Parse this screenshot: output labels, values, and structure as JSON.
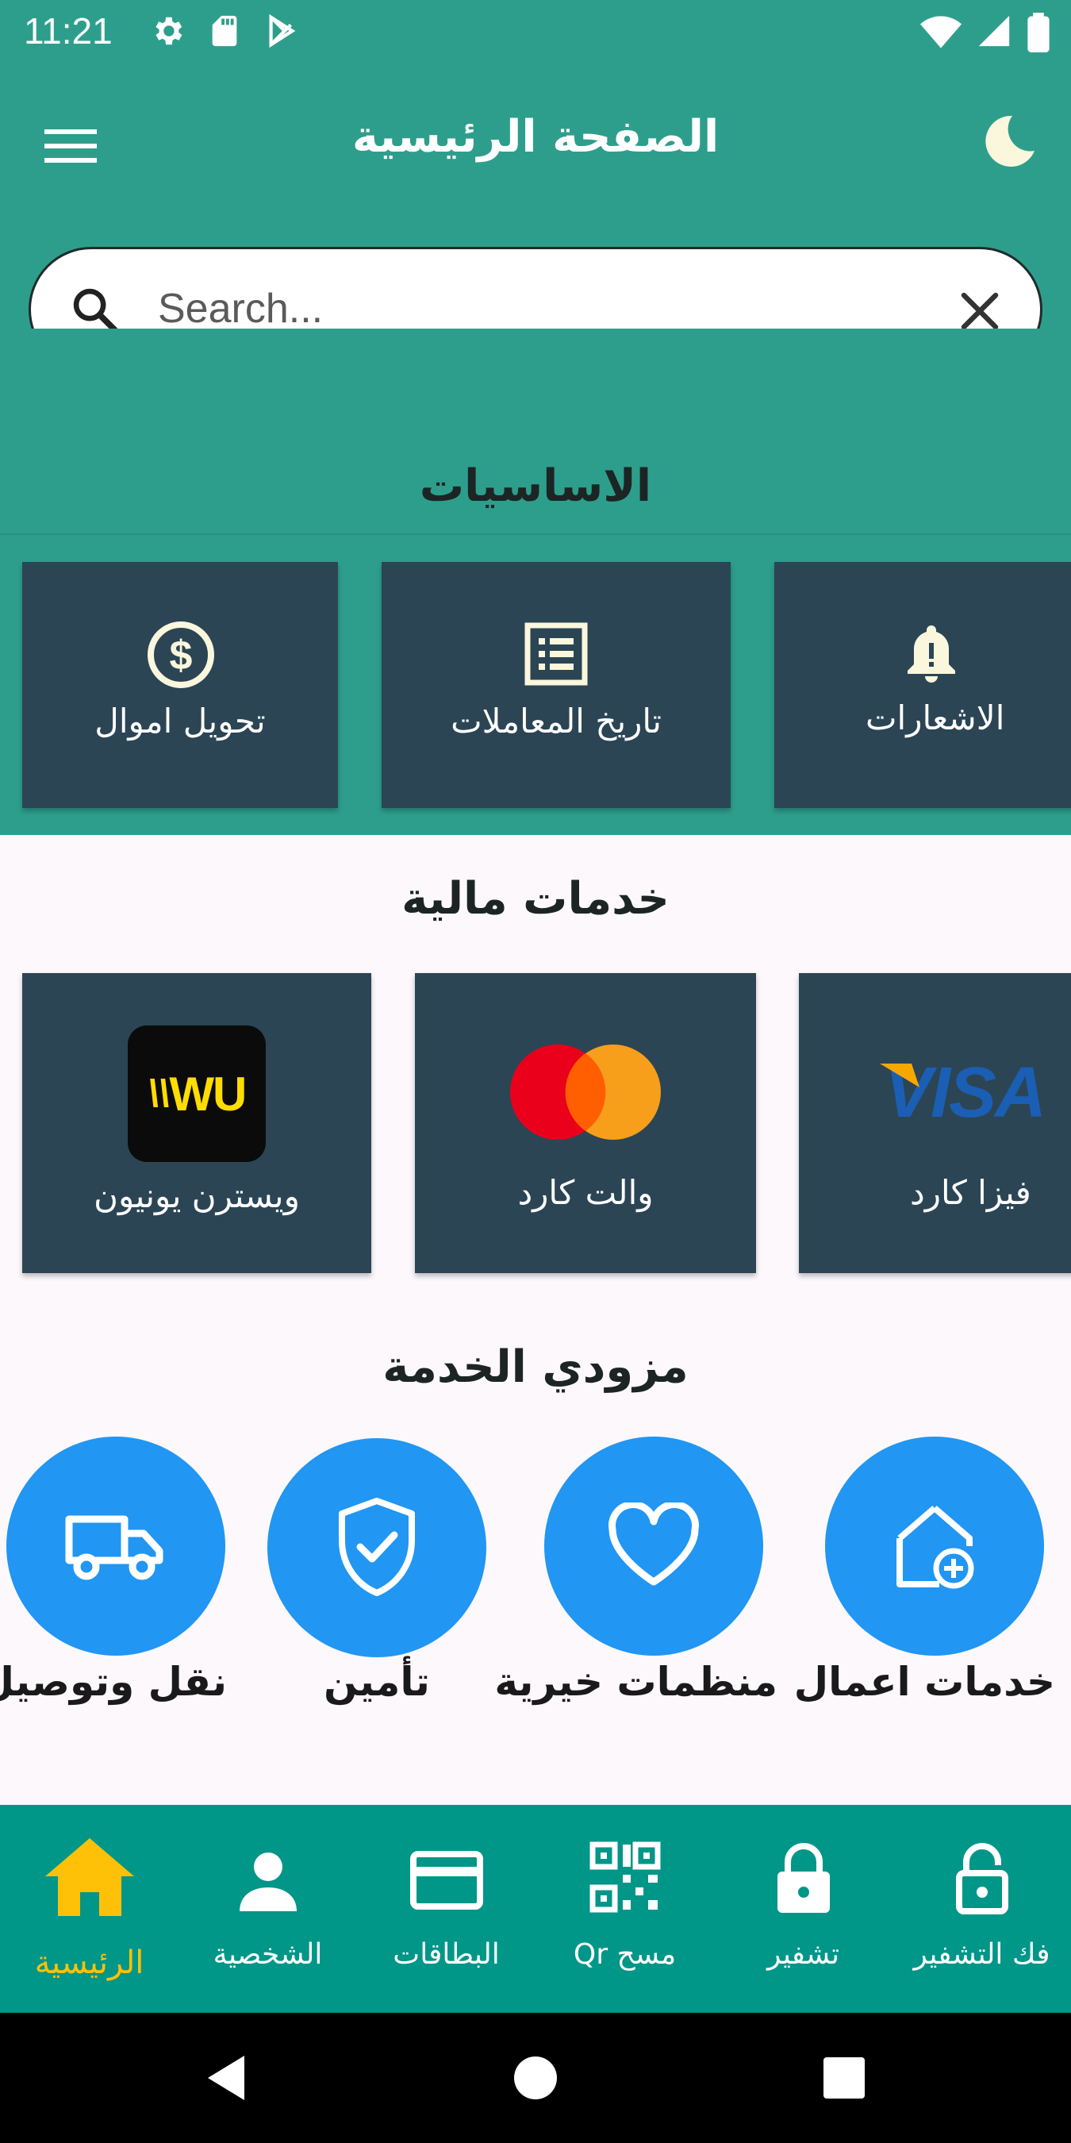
{
  "status_bar": {
    "time": "11:21"
  },
  "app_bar": {
    "title": "الصفحة الرئيسية"
  },
  "search": {
    "placeholder": "Search..."
  },
  "basics": {
    "title": "الاساسيات",
    "items": [
      {
        "label": "تحويل اموال",
        "icon": "dollar-circle-icon"
      },
      {
        "label": "تاريخ المعاملات",
        "icon": "list-icon"
      },
      {
        "label": "الاشعارات",
        "icon": "bell-alert-icon"
      }
    ]
  },
  "financial": {
    "title": "خدمات مالية",
    "items": [
      {
        "label": "ويسترن يونيون",
        "icon": "western-union-logo",
        "logo_text": "WU"
      },
      {
        "label": "والت كارد",
        "icon": "mastercard-logo"
      },
      {
        "label": "فيزا كارد",
        "icon": "visa-logo",
        "logo_text": "VISA"
      }
    ]
  },
  "providers": {
    "title": "مزودي الخدمة",
    "items": [
      {
        "label": "نقل وتوصيل",
        "icon": "truck-icon"
      },
      {
        "label": "تأمين",
        "icon": "shield-check-icon"
      },
      {
        "label": "منظمات خيرية",
        "icon": "heart-icon"
      },
      {
        "label": "خدمات اعمال",
        "icon": "home-add-icon"
      }
    ]
  },
  "bottom_nav": {
    "items": [
      {
        "label": "الرئيسية",
        "icon": "home-icon",
        "active": true
      },
      {
        "label": "الشخصية",
        "icon": "person-icon"
      },
      {
        "label": "البطاقات",
        "icon": "credit-card-icon"
      },
      {
        "label": "مسح Qr",
        "icon": "qr-code-icon"
      },
      {
        "label": "تشفير",
        "icon": "lock-icon"
      },
      {
        "label": "فك التشفير",
        "icon": "lock-open-icon"
      }
    ]
  },
  "colors": {
    "primary": "#2e9e8c",
    "tile": "#2b4555",
    "accent_blue": "#2196f3",
    "nav": "#009688",
    "nav_active": "#ffc107"
  }
}
